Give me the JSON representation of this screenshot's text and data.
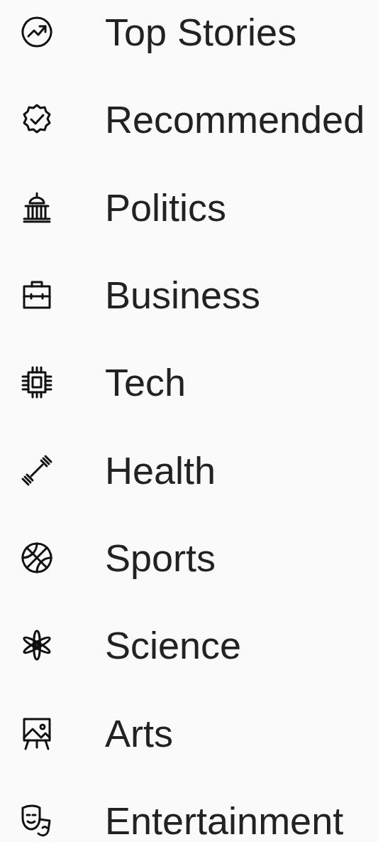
{
  "menu": {
    "items": [
      {
        "label": "Top Stories"
      },
      {
        "label": "Recommended"
      },
      {
        "label": "Politics"
      },
      {
        "label": "Business"
      },
      {
        "label": "Tech"
      },
      {
        "label": "Health"
      },
      {
        "label": "Sports"
      },
      {
        "label": "Science"
      },
      {
        "label": "Arts"
      },
      {
        "label": "Entertainment"
      }
    ]
  }
}
